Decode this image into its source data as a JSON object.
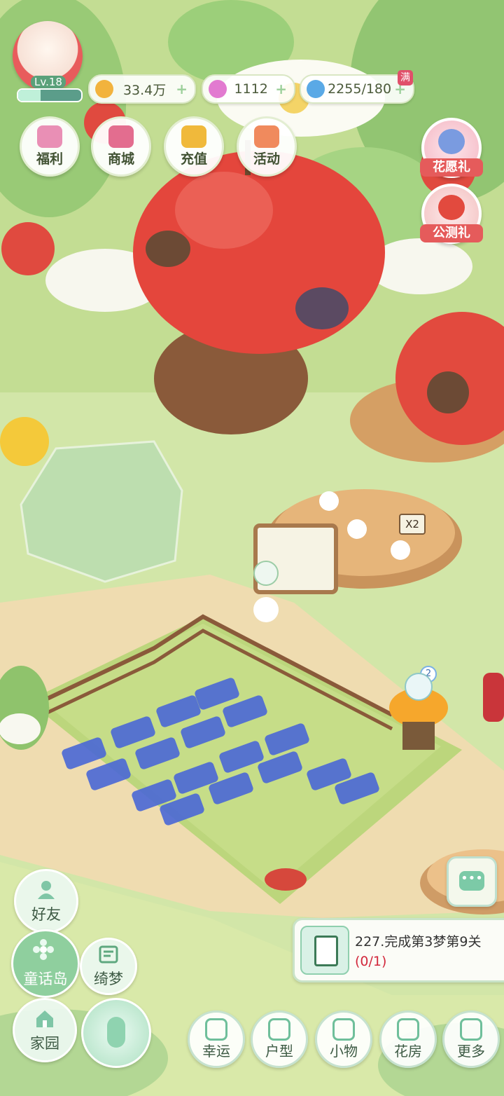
{
  "player": {
    "level": "Lv.18",
    "exp_fraction": 0.35
  },
  "currencies": [
    {
      "name": "gold",
      "icon": "coin-icon",
      "value": "33.4万",
      "color": "#f2b33d"
    },
    {
      "name": "gem",
      "icon": "flower-gem-icon",
      "value": "1112",
      "color": "#e27ad0"
    },
    {
      "name": "water",
      "icon": "water-drop-icon",
      "value": "2255/180",
      "color": "#5aa9e6",
      "badge": "满"
    }
  ],
  "top_menu": [
    {
      "label": "福利",
      "icon": "gift-icon"
    },
    {
      "label": "商城",
      "icon": "cart-icon"
    },
    {
      "label": "充值",
      "icon": "diamond-v-icon"
    },
    {
      "label": "活动",
      "icon": "gamepad-icon"
    }
  ],
  "side_events": [
    {
      "label": "花愿礼",
      "icon": "flower-bouquet-icon"
    },
    {
      "label": "公测礼",
      "icon": "apple-gift-icon"
    }
  ],
  "task": {
    "title": "227.完成第3梦第9关",
    "progress": "(0/1)"
  },
  "left_menu": [
    {
      "label": "好友",
      "icon": "friend-icon"
    },
    {
      "label": "童话岛",
      "icon": "flower-island-icon"
    },
    {
      "label": "绮梦",
      "icon": "dream-book-icon"
    },
    {
      "label": "家园",
      "icon": "home-icon"
    }
  ],
  "bottom_nav": [
    {
      "label": "幸运",
      "icon": "lucky-spin-icon"
    },
    {
      "label": "户型",
      "icon": "layout-cube-icon"
    },
    {
      "label": "小物",
      "icon": "castle-icon"
    },
    {
      "label": "花房",
      "icon": "greenhouse-icon"
    },
    {
      "label": "更多",
      "icon": "double-chevron-up-icon"
    }
  ],
  "scene_badges": {
    "multiplier": "X2",
    "well_count": "2"
  },
  "colors": {
    "grass": "#cfe3a4",
    "path": "#f0deb4",
    "apple": "#e4463c",
    "accent_green": "#8fcf9e"
  }
}
